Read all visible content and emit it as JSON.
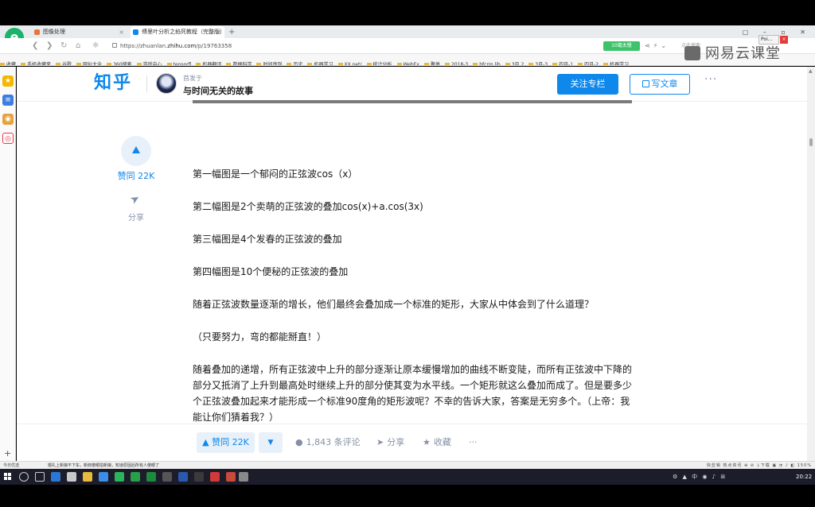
{
  "browser": {
    "brand_letter": "e",
    "tabs": [
      {
        "title": "图像处理",
        "active": false
      },
      {
        "title": "傅里叶分析之掐死教程（完整版）",
        "active": true
      }
    ],
    "new_tab": "+",
    "url_prefix": "https://zhuanlan.",
    "url_domain": "zhihu.com",
    "url_path": "/p/19763358",
    "speed_badge": "10毫太慢",
    "search_placeholder": "点此搜索",
    "popup_label": "Poi...",
    "window_controls": "▢ – ▫ ✕",
    "bookmarks": [
      "收藏",
      "手机收藏夹",
      "谷歌",
      "网址大全",
      "360搜索",
      "游戏中心",
      "tensorfl",
      "机器翻译",
      "数据科学",
      "时间序列",
      "历史",
      "机器学习",
      "XX.net/",
      "统计分析",
      "WebEx",
      "聚类",
      "2018-3",
      "bfcrm.lib",
      "3月 2",
      "3月-3",
      "四月-1",
      "四月-2",
      "机器学习"
    ]
  },
  "watermark": "网易云课堂",
  "zhihu": {
    "logo": "知乎",
    "published_in_label": "首发于",
    "column_name": "与时间无关的故事",
    "follow_button": "关注专栏",
    "write_button": "写文章",
    "more": "···",
    "side_vote_count": "赞同 22K",
    "side_share_label": "分享"
  },
  "article": {
    "paragraphs": [
      "第一幅图是一个郁闷的正弦波cos（x）",
      "第二幅图是2个卖萌的正弦波的叠加cos(x)+a.cos(3x)",
      "第三幅图是4个发春的正弦波的叠加",
      "第四幅图是10个便秘的正弦波的叠加",
      "随着正弦波数量逐渐的增长，他们最终会叠加成一个标准的矩形，大家从中体会到了什么道理？",
      "（只要努力，弯的都能掰直！）",
      "随着叠加的递增，所有正弦波中上升的部分逐渐让原本缓慢增加的曲线不断变陡，而所有正弦波中下降的部分又抵消了上升到最高处时继续上升的部分使其变为水平线。一个矩形就这么叠加而成了。但是要多少个正弦波叠加起来才能形成一个标准90度角的矩形波呢？不幸的告诉大家，答案是无穷多个。（上帝：我能让你们猜着我？）"
    ]
  },
  "actions": {
    "vote_up": "▲ 赞同 22K",
    "vote_down": "▼",
    "comments": "1,843 条评论",
    "share": "分享",
    "favorite": "收藏",
    "more": "···"
  },
  "statusbar": {
    "left": "今日优选",
    "news": "婚礼上新娘不下车，新郎傻眼拍新娘，知道原因后所有人傻眼了",
    "right": "快剪辑  热点资讯  ⊕  ⊘  ↓下载  ▣  ◔  ♪  ◧  150%"
  },
  "taskbar": {
    "tray": "⚙ ▲ 中 ◉ ♪ ⊞",
    "clock": "20:22"
  },
  "colors": {
    "zhihu_blue": "#0f88eb",
    "muted_text": "#8590a6",
    "brand_green": "#1bb36b"
  }
}
